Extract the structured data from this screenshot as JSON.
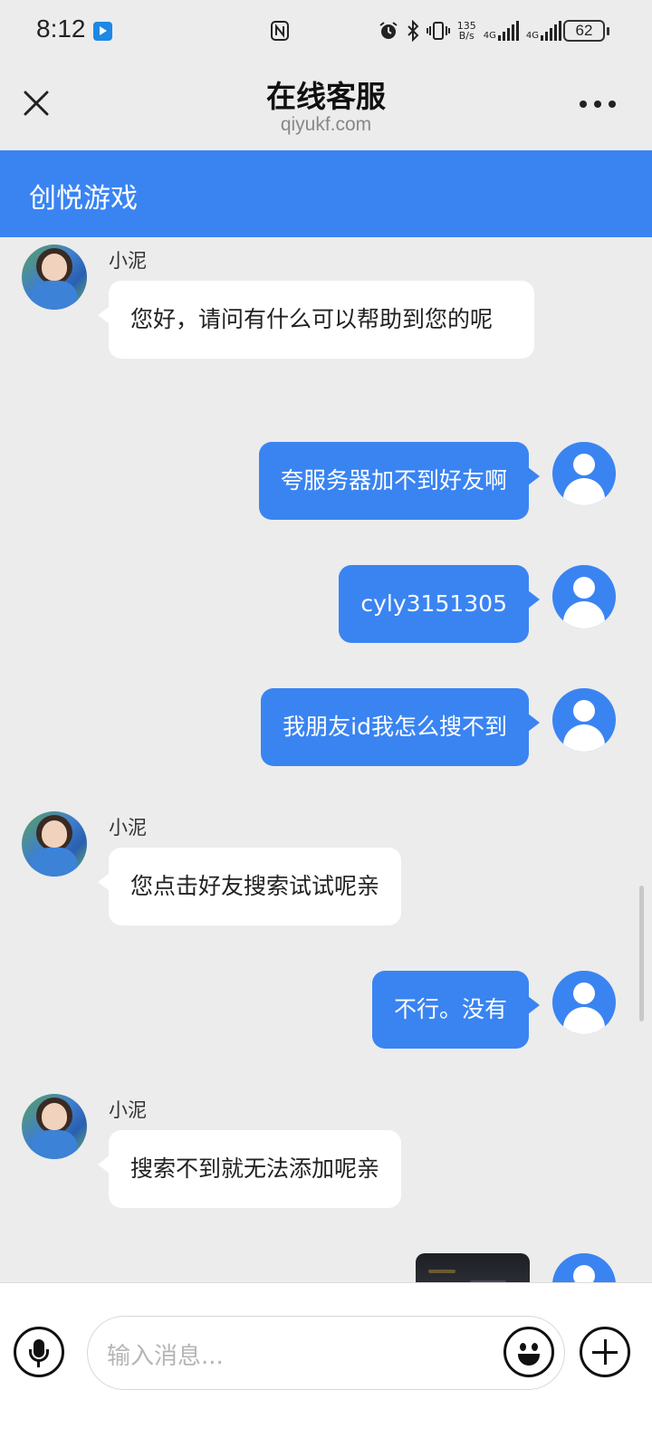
{
  "status_bar": {
    "time": "8:12",
    "net_speed_value": "135",
    "net_speed_unit": "B/s",
    "network_1": "4G",
    "network_2": "4G",
    "battery": "62"
  },
  "nav": {
    "title": "在线客服",
    "subtitle": "qiyukf.com"
  },
  "header": {
    "brand": "创悦游戏"
  },
  "messages": [
    {
      "side": "agent",
      "sender": "小泥",
      "text": "您好，请问有什么可以帮助到您的呢"
    },
    {
      "side": "user",
      "text": "夸服务器加不到好友啊"
    },
    {
      "side": "user",
      "text": "cyly3151305"
    },
    {
      "side": "user",
      "text": "我朋友id我怎么搜不到"
    },
    {
      "side": "agent",
      "sender": "小泥",
      "text": "您点击好友搜索试试呢亲"
    },
    {
      "side": "user",
      "text": "不行。没有"
    },
    {
      "side": "agent",
      "sender": "小泥",
      "text": "搜索不到就无法添加呢亲"
    },
    {
      "side": "user",
      "type": "image"
    }
  ],
  "input": {
    "placeholder": "输入消息..."
  },
  "icons": {
    "close": "close-icon",
    "more": "more-icon",
    "mic": "microphone-icon",
    "emoji": "emoji-icon",
    "plus": "plus-icon"
  },
  "colors": {
    "accent": "#3a84f2",
    "background": "#ececec",
    "bubble_in": "#ffffff"
  }
}
